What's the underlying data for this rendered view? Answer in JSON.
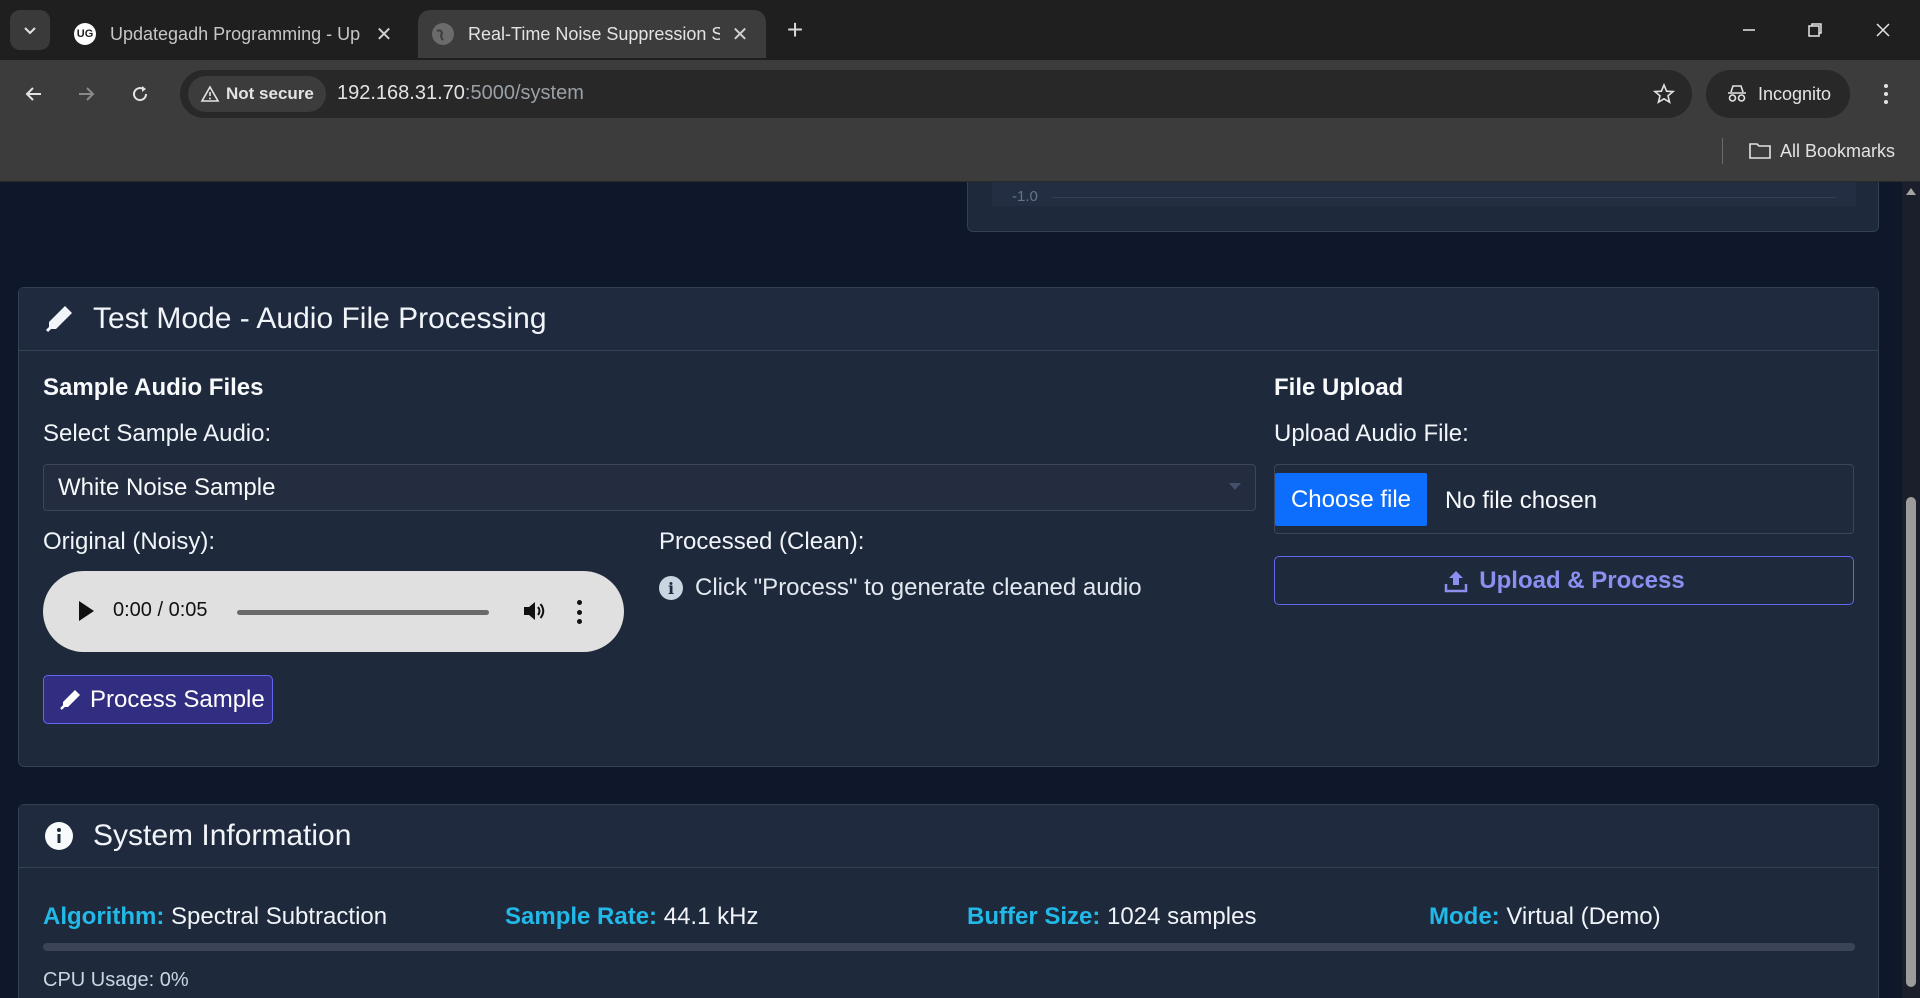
{
  "browser": {
    "tabs": [
      {
        "title": "Updategadh Programming - Up",
        "favicon_text": "UG",
        "active": false
      },
      {
        "title": "Real-Time Noise Suppression Sy",
        "favicon_text": "",
        "active": true
      }
    ],
    "security_label": "Not secure",
    "url_host": "192.168.31.70",
    "url_rest": ":5000/system",
    "profile_label": "Incognito",
    "bookmarks_label": "All Bookmarks"
  },
  "waveform_chart": {
    "tick_label": "-1.0"
  },
  "test_mode": {
    "title": "Test Mode - Audio File Processing",
    "sample_section_title": "Sample Audio Files",
    "select_label": "Select Sample Audio:",
    "selected_sample": "White Noise Sample",
    "original_label": "Original (Noisy):",
    "player_time": "0:00 / 0:05",
    "processed_label": "Processed (Clean):",
    "processed_hint": "Click \"Process\" to generate cleaned audio",
    "process_button": "Process Sample",
    "upload_section_title": "File Upload",
    "upload_label": "Upload Audio File:",
    "choose_file_button": "Choose file",
    "no_file_text": "No file chosen",
    "upload_button": "Upload & Process"
  },
  "system_info": {
    "title": "System Information",
    "algorithm_key": "Algorithm:",
    "algorithm_value": "Spectral Subtraction",
    "sample_rate_key": "Sample Rate:",
    "sample_rate_value": "44.1 kHz",
    "buffer_key": "Buffer Size:",
    "buffer_value": "1024 samples",
    "mode_key": "Mode:",
    "mode_value": "Virtual (Demo)",
    "cpu_usage_percent": 0,
    "cpu_label": "CPU Usage: 0%"
  },
  "colors": {
    "page_bg": "#0f172a",
    "card_bg": "#1e293b",
    "accent_cyan": "#22b8e8",
    "accent_indigo": "#6366f1",
    "file_button_blue": "#0d6efd"
  }
}
